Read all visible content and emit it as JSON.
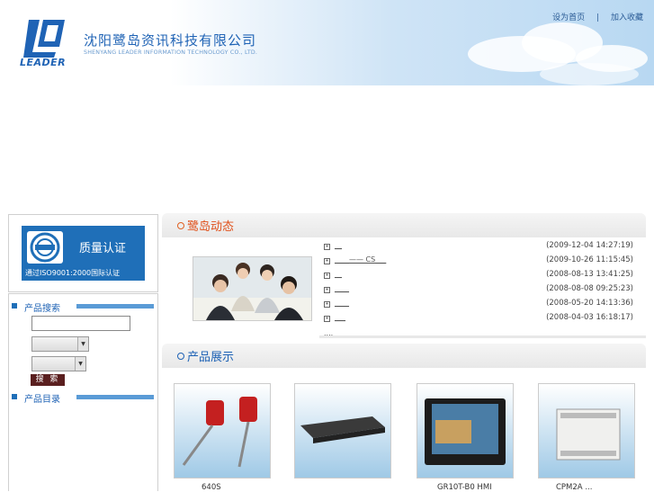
{
  "header": {
    "logo_text": "LEADER",
    "company_cn": "沈阳鹭岛资讯科技有限公司",
    "company_en": "SHENYANG LEADER INFORMATION TECHNOLOGY CO., LTD.",
    "links": [
      "设为首页",
      "加入收藏"
    ],
    "link_separator": "|"
  },
  "sidebar": {
    "cert": {
      "title": "质量认证",
      "subtitle": "通过ISO9001:2000国际认证"
    },
    "product_search_label": "产品搜索",
    "search_input_value": "",
    "select1_value": "",
    "select2_value": "",
    "search_button_label": "搜 索",
    "product_catalog_label": "产品目录"
  },
  "news": {
    "title": "鹭岛动态",
    "items": [
      {
        "title": "__",
        "date": "(2009-12-04 14:27:19)"
      },
      {
        "title": "____——  CS___",
        "date": "(2009-10-26 11:15:45)"
      },
      {
        "title": "__",
        "date": "(2008-08-13 13:41:25)"
      },
      {
        "title": "____",
        "date": "(2008-08-08 09:25:23)"
      },
      {
        "title": "____",
        "date": "(2008-05-20 14:13:36)"
      },
      {
        "title": "___",
        "date": "(2008-04-03 16:18:17)"
      }
    ],
    "more_label": "...."
  },
  "products": {
    "title": "产品展示",
    "items": [
      {
        "caption": "640S"
      },
      {
        "caption": ""
      },
      {
        "caption": "GR10T-B0 HMI"
      },
      {
        "caption": "CPM2A          ..."
      }
    ]
  },
  "colors": {
    "brand_blue": "#1f63b5",
    "news_orange": "#e0501a",
    "search_button": "#5a1f1f"
  }
}
